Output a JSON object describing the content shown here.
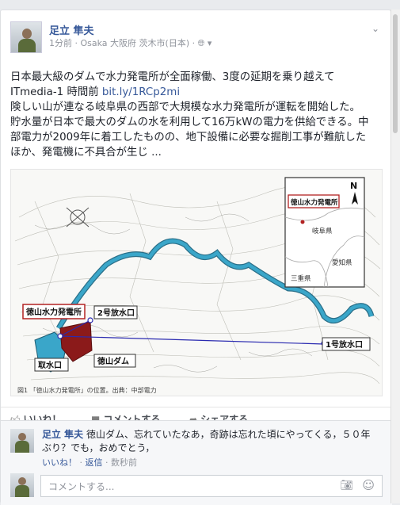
{
  "post": {
    "author": "足立 隼夫",
    "time": "1分前",
    "location": "· Osaka 大阪府 茨木市(日本) ·",
    "privacy_icon": "globe-icon",
    "menu_icon": "chevron-down-icon",
    "headline": "日本最大級のダムで水力発電所が全面稼働、3度の延期を乗り越えて",
    "source": "ITmedia-1 時間前",
    "link": "bit.ly/1RCp2mi",
    "body_line1": "険しい山が連なる岐阜県の西部で大規模な水力発電所が運転を開始した。",
    "body_line2": "貯水量が日本で最大のダムの水を利用して16万kWの電力を供給できる。中",
    "body_line3": "部電力が2009年に着工したものの、地下設備に必要な掘削工事が難航した",
    "body_line4": "ほか、発電機に不具合が生じ ..."
  },
  "map": {
    "station_label": "徳山水力発電所",
    "outlet2": "2号放水口",
    "outlet1": "1号放水口",
    "intake": "取水口",
    "dam": "徳山ダム",
    "inset_station": "徳山水力発電所",
    "inset_gifu": "岐阜県",
    "inset_aichi": "愛知県",
    "inset_mie": "三重県",
    "north": "N",
    "caption": "図1 「徳山水力発電所」の位置。出典：中部電力"
  },
  "actions": {
    "like": "いいね！",
    "comment": "コメントする",
    "share": "シェアする"
  },
  "comment": {
    "author": "足立 隼夫",
    "text": "徳山ダム、忘れていたなあ，奇跡は忘れた頃にやってくる，５０年ぶり？でも，おめでとう，",
    "like": "いいね！",
    "reply": "返信",
    "time": "数秒前",
    "sep": " · "
  },
  "composer": {
    "placeholder": "コメントする..."
  },
  "colors": {
    "link": "#365899",
    "river": "#3aa6c9",
    "dam": "#8b1a1a"
  }
}
